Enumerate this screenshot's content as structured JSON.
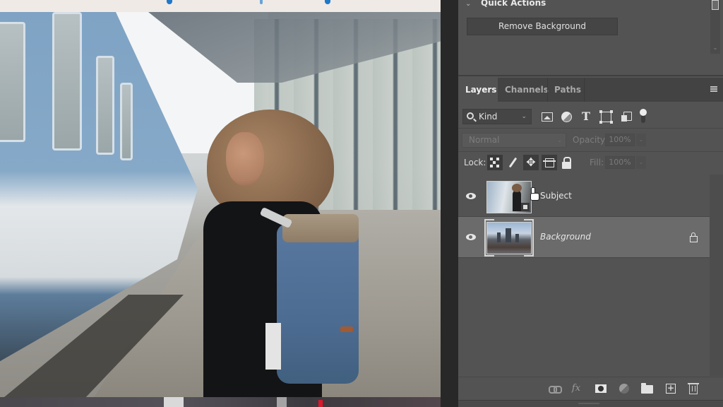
{
  "canvas": {
    "description": "Photo of woman with blue backpack on train platform"
  },
  "quick_actions": {
    "title": "Quick Actions",
    "remove_background_label": "Remove Background"
  },
  "layers_panel": {
    "tabs": [
      {
        "label": "Layers",
        "active": true
      },
      {
        "label": "Channels",
        "active": false
      },
      {
        "label": "Paths",
        "active": false
      }
    ],
    "filter": {
      "kind_label": "Kind",
      "filter_icons": [
        "pixel-layer-filter-icon",
        "adjustment-layer-filter-icon",
        "type-layer-filter-icon",
        "shape-layer-filter-icon",
        "smart-object-filter-icon"
      ]
    },
    "blend_mode": "Normal",
    "opacity_label": "Opacity:",
    "opacity_value": "100%",
    "lock_label": "Lock:",
    "fill_label": "Fill:",
    "fill_value": "100%",
    "layers": [
      {
        "name": "Subject",
        "type": "smart-object",
        "visible": true,
        "selected": false,
        "locked": false,
        "italic": false
      },
      {
        "name": "Background",
        "type": "pixel",
        "visible": true,
        "selected": true,
        "locked": true,
        "italic": true
      }
    ],
    "footer_icons": [
      "link-layers-icon",
      "fx-icon",
      "add-mask-icon",
      "adjustment-layer-icon",
      "group-folder-icon",
      "new-layer-icon",
      "delete-layer-icon"
    ]
  },
  "footer": {
    "fx_label": "fx",
    "new_layer_glyph": "+"
  },
  "glyphs": {
    "collapse_chevron": "⌄",
    "dropdown_caret": "⌄",
    "type_T": "T",
    "move_arrows": "✥",
    "scroll_down": "⌄"
  }
}
